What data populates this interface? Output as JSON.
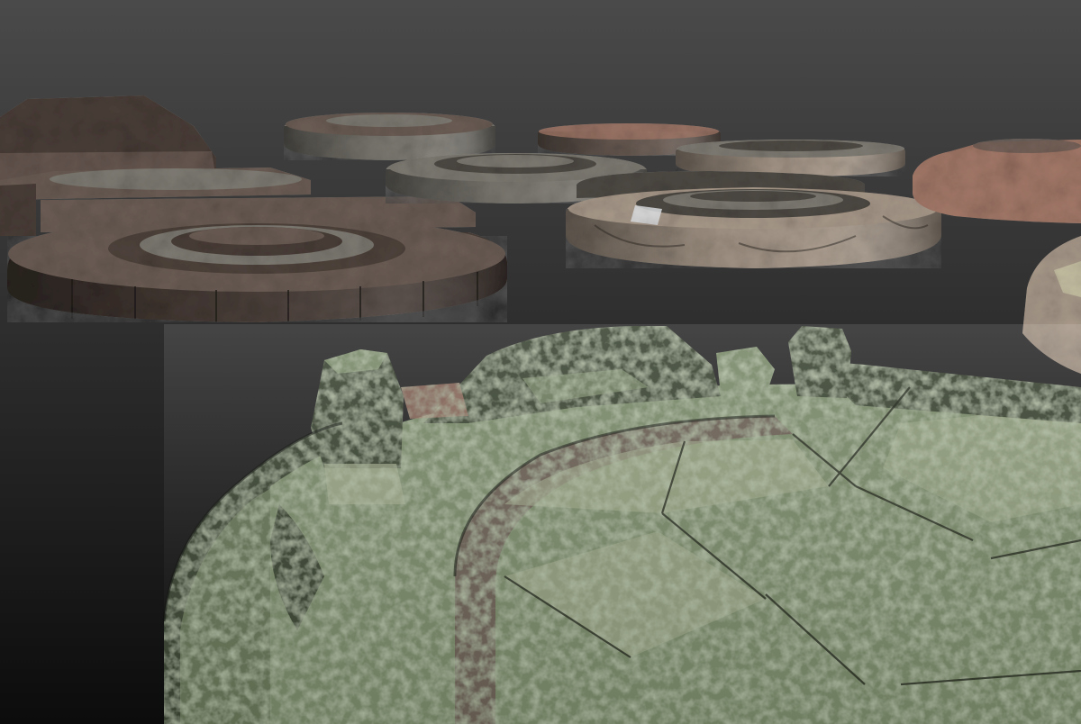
{
  "scene": {
    "background_top": "#4a4a4a",
    "background_bottom": "#0c0c0c",
    "stone_colors": {
      "dark_brown": "#4a3e38",
      "brown_mid": "#6b5d55",
      "rust": "#a27868",
      "grey": "#7d7a72",
      "marble_beige": "#a8998a",
      "marble_dark": "#4e4a44",
      "moss_green": "#7a8a6a",
      "moss_dark": "#3e4634",
      "moss_light": "#a4ad8e"
    }
  }
}
